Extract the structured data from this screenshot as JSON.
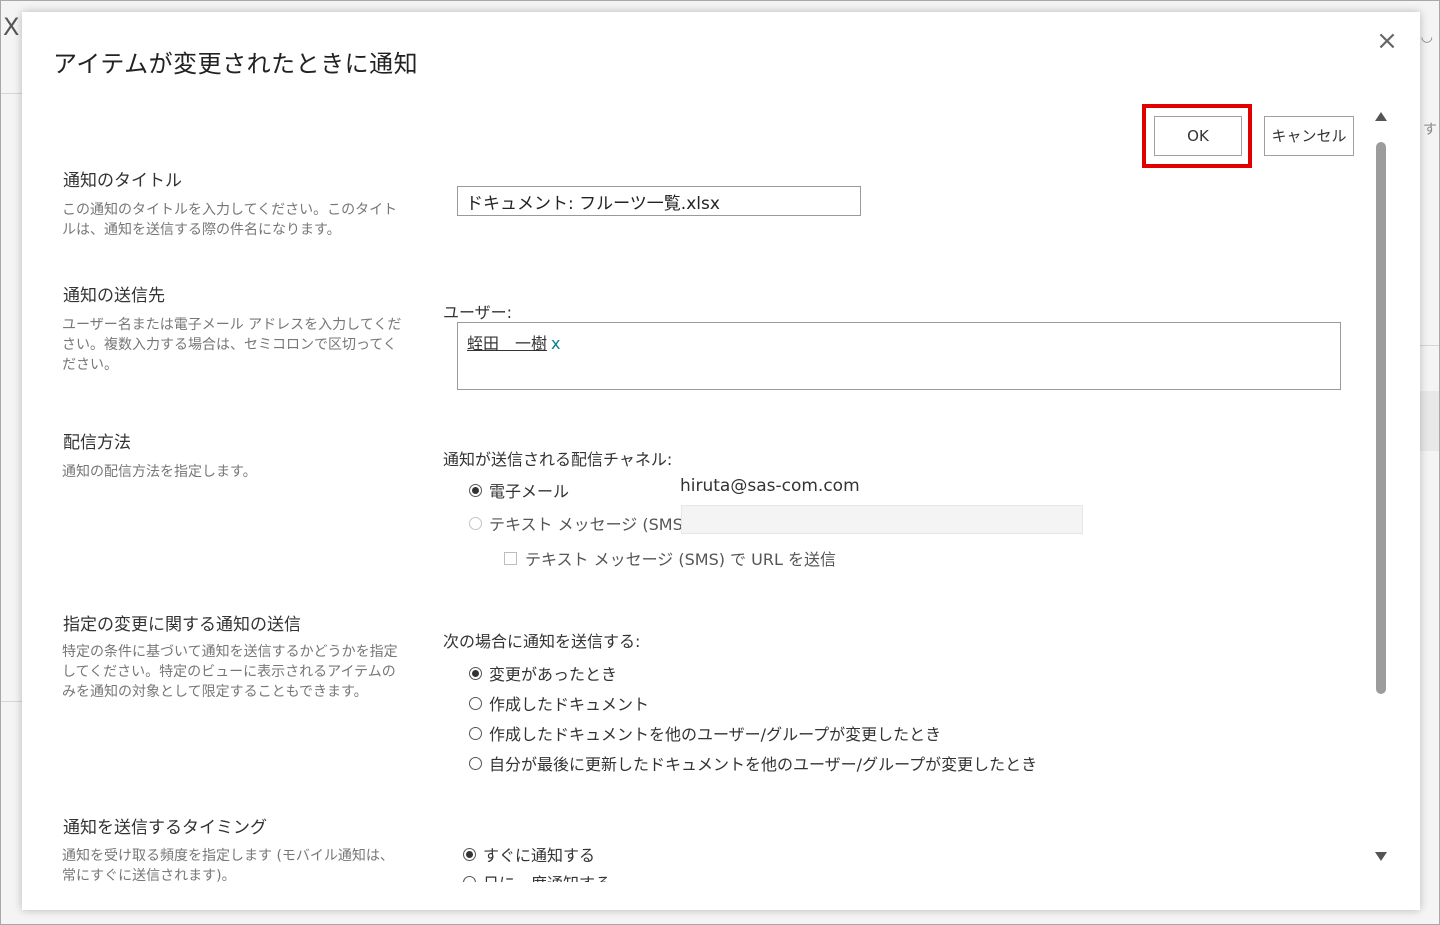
{
  "background": {
    "close_glyph": "X",
    "right_icon": "◡",
    "right_text": "す"
  },
  "dialog": {
    "title": "アイテムが変更されたときに通知",
    "close_glyph": "×",
    "ok_label": "OK",
    "cancel_label": "キャンセル"
  },
  "sections": {
    "title": {
      "heading": "通知のタイトル",
      "description": "この通知のタイトルを入力してください。このタイトルは、通知を送信する際の件名になります。",
      "value": "ドキュメント: フルーツ一覧.xlsx"
    },
    "recipients": {
      "heading": "通知の送信先",
      "description": "ユーザー名または電子メール アドレスを入力してください。複数入力する場合は、セミコロンで区切ってください。",
      "users_label": "ユーザー:",
      "user_name": "蛭田　一樹",
      "remove_glyph": "x"
    },
    "delivery": {
      "heading": "配信方法",
      "description": "通知の配信方法を指定します。",
      "channel_label": "通知が送信される配信チャネル:",
      "email_label": "電子メール",
      "email_value": "hiruta@sas-com.com",
      "sms_label": "テキスト メッセージ (SMS)",
      "sms_url_label": "テキスト メッセージ (SMS) で URL を送信"
    },
    "changes": {
      "heading": "指定の変更に関する通知の送信",
      "description": "特定の条件に基づいて通知を送信するかどうかを指定してください。特定のビューに表示されるアイテムのみを通知の対象として限定することもできます。",
      "label": "次の場合に通知を送信する:",
      "options": [
        "変更があったとき",
        "作成したドキュメント",
        "作成したドキュメントを他のユーザー/グループが変更したとき",
        "自分が最後に更新したドキュメントを他のユーザー/グループが変更したとき"
      ]
    },
    "timing": {
      "heading": "通知を送信するタイミング",
      "description": "通知を受け取る頻度を指定します (モバイル通知は、常にすぐに送信されます)。",
      "options": [
        "すぐに通知する",
        "日に一度通知する"
      ]
    }
  }
}
